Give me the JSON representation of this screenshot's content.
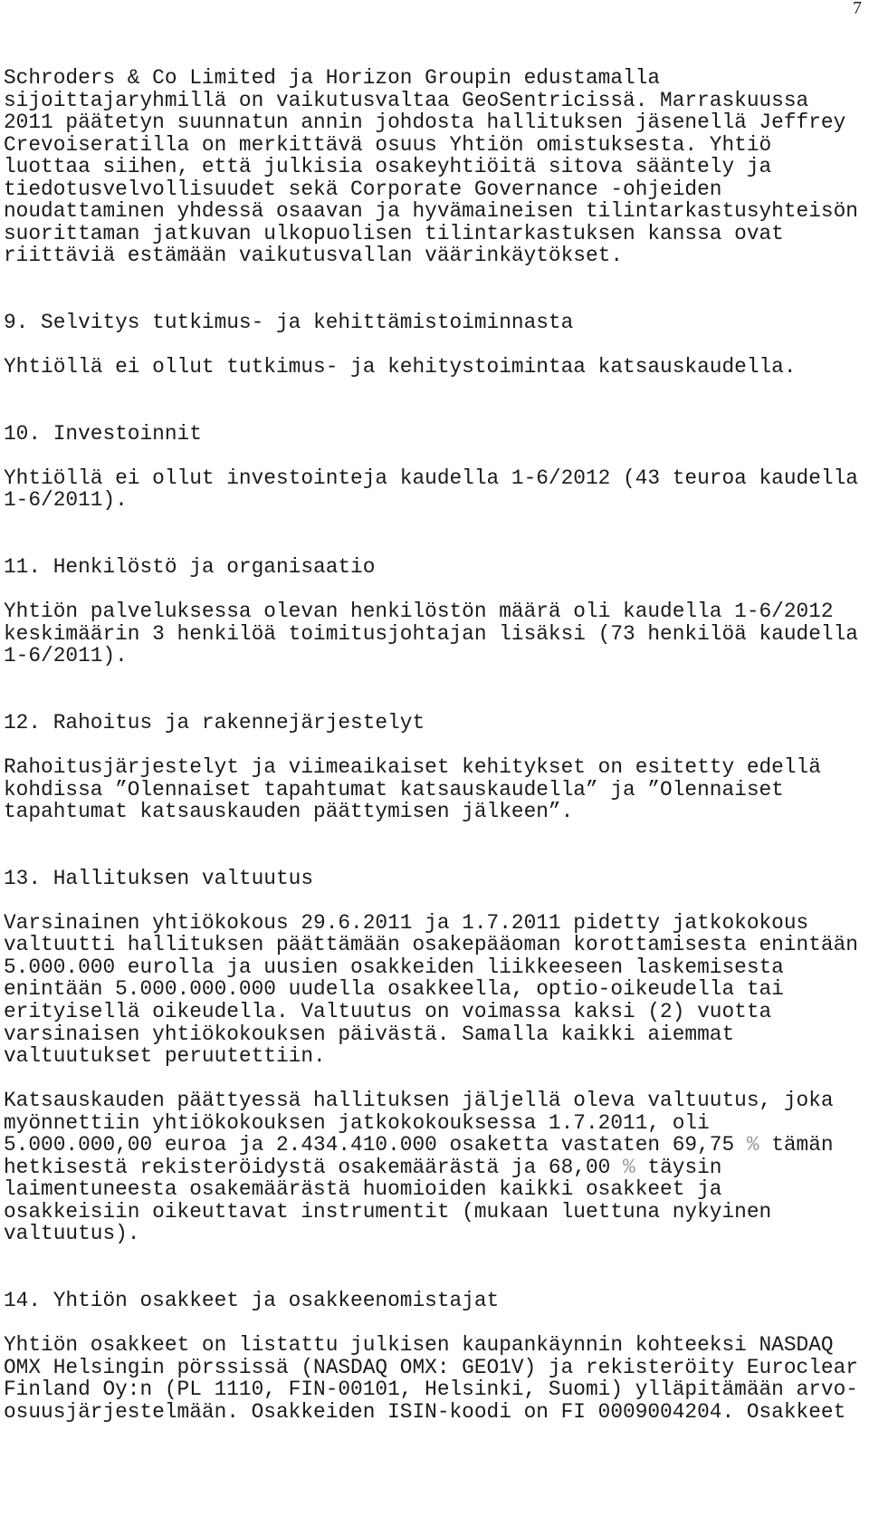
{
  "page_number": "7",
  "intro": {
    "lines": [
      "Schroders & Co Limited ja Horizon Groupin edustamalla",
      "sijoittajaryhmillä on vaikutusvaltaa GeoSentricissä. Marraskuussa",
      "2011 päätetyn suunnatun annin johdosta hallituksen jäsenellä Jeffrey",
      "Crevoiseratilla on merkittävä osuus Yhtiön omistuksesta. Yhtiö",
      "luottaa siihen, että julkisia osakeyhtiöitä sitova sääntely ja",
      "tiedotusvelvollisuudet sekä Corporate Governance -ohjeiden",
      "noudattaminen yhdessä osaavan ja hyvämaineisen tilintarkastusyhteisön",
      "suorittaman jatkuvan ulkopuolisen tilintarkastuksen kanssa ovat",
      "riittäviä estämään vaikutusvallan väärinkäytökset."
    ]
  },
  "sections": {
    "s9": {
      "heading": "9. Selvitys tutkimus- ja kehittämistoiminnasta",
      "body": "Yhtiöllä ei ollut tutkimus- ja kehitystoimintaa katsauskaudella."
    },
    "s10": {
      "heading": "10. Investoinnit",
      "body_lines": [
        "Yhtiöllä ei ollut investointeja kaudella 1-6/2012 (43 teuroa kaudella",
        "1-6/2011)."
      ]
    },
    "s11": {
      "heading": "11. Henkilöstö ja organisaatio",
      "body_lines": [
        "Yhtiön palveluksessa olevan henkilöstön määrä oli kaudella 1-6/2012",
        "keskimäärin 3 henkilöä toimitusjohtajan lisäksi (73 henkilöä kaudella",
        "1-6/2011)."
      ]
    },
    "s12": {
      "heading": "12. Rahoitus ja rakennejärjestelyt",
      "body_lines": [
        "Rahoitusjärjestelyt ja viimeaikaiset kehitykset on esitetty edellä",
        "kohdissa ”Olennaiset tapahtumat katsauskaudella” ja ”Olennaiset",
        "tapahtumat katsauskauden päättymisen jälkeen”."
      ]
    },
    "s13": {
      "heading": "13. Hallituksen valtuutus",
      "para1_lines": [
        "Varsinainen yhtiökokous 29.6.2011 ja 1.7.2011 pidetty jatkokokous",
        "valtuutti hallituksen päättämään osakepääoman korottamisesta enintään",
        "5.000.000 eurolla ja uusien osakkeiden liikkeeseen laskemisesta",
        "enintään 5.000.000.000 uudella osakkeella, optio-oikeudella tai",
        "erityisellä oikeudella. Valtuutus on voimassa kaksi (2) vuotta",
        "varsinaisen yhtiökokouksen päivästä. Samalla kaikki aiemmat",
        "valtuutukset peruutettiin."
      ],
      "para2": {
        "line1": "Katsauskauden päättyessä hallituksen jäljellä oleva valtuutus, joka",
        "line2": "myönnettiin yhtiökokouksen jatkokokouksessa 1.7.2011, oli",
        "line3_before": "5.000.000,00 euroa ja 2.434.410.000 osaketta vastaten 69,75 ",
        "line3_pct": "%",
        "line3_after": " tämän",
        "line4_before": "hetkisestä rekisteröidystä osakemäärästä ja 68,00 ",
        "line4_pct": "%",
        "line4_after": " täysin",
        "line5": "laimentuneesta osakemäärästä huomioiden kaikki osakkeet ja",
        "line6": "osakkeisiin oikeuttavat instrumentit (mukaan luettuna nykyinen",
        "line7": "valtuutus)."
      }
    },
    "s14": {
      "heading": "14. Yhtiön osakkeet ja osakkeenomistajat",
      "body_lines": [
        "Yhtiön osakkeet on listattu julkisen kaupankäynnin kohteeksi NASDAQ",
        "OMX Helsingin pörssissä (NASDAQ OMX: GEO1V) ja rekisteröity Euroclear",
        "Finland Oy:n (PL 1110, FIN-00101, Helsinki, Suomi) ylläpitämään arvo-",
        "osuusjärjestelmään. Osakkeiden ISIN-koodi on FI 0009004204. Osakkeet"
      ]
    }
  }
}
